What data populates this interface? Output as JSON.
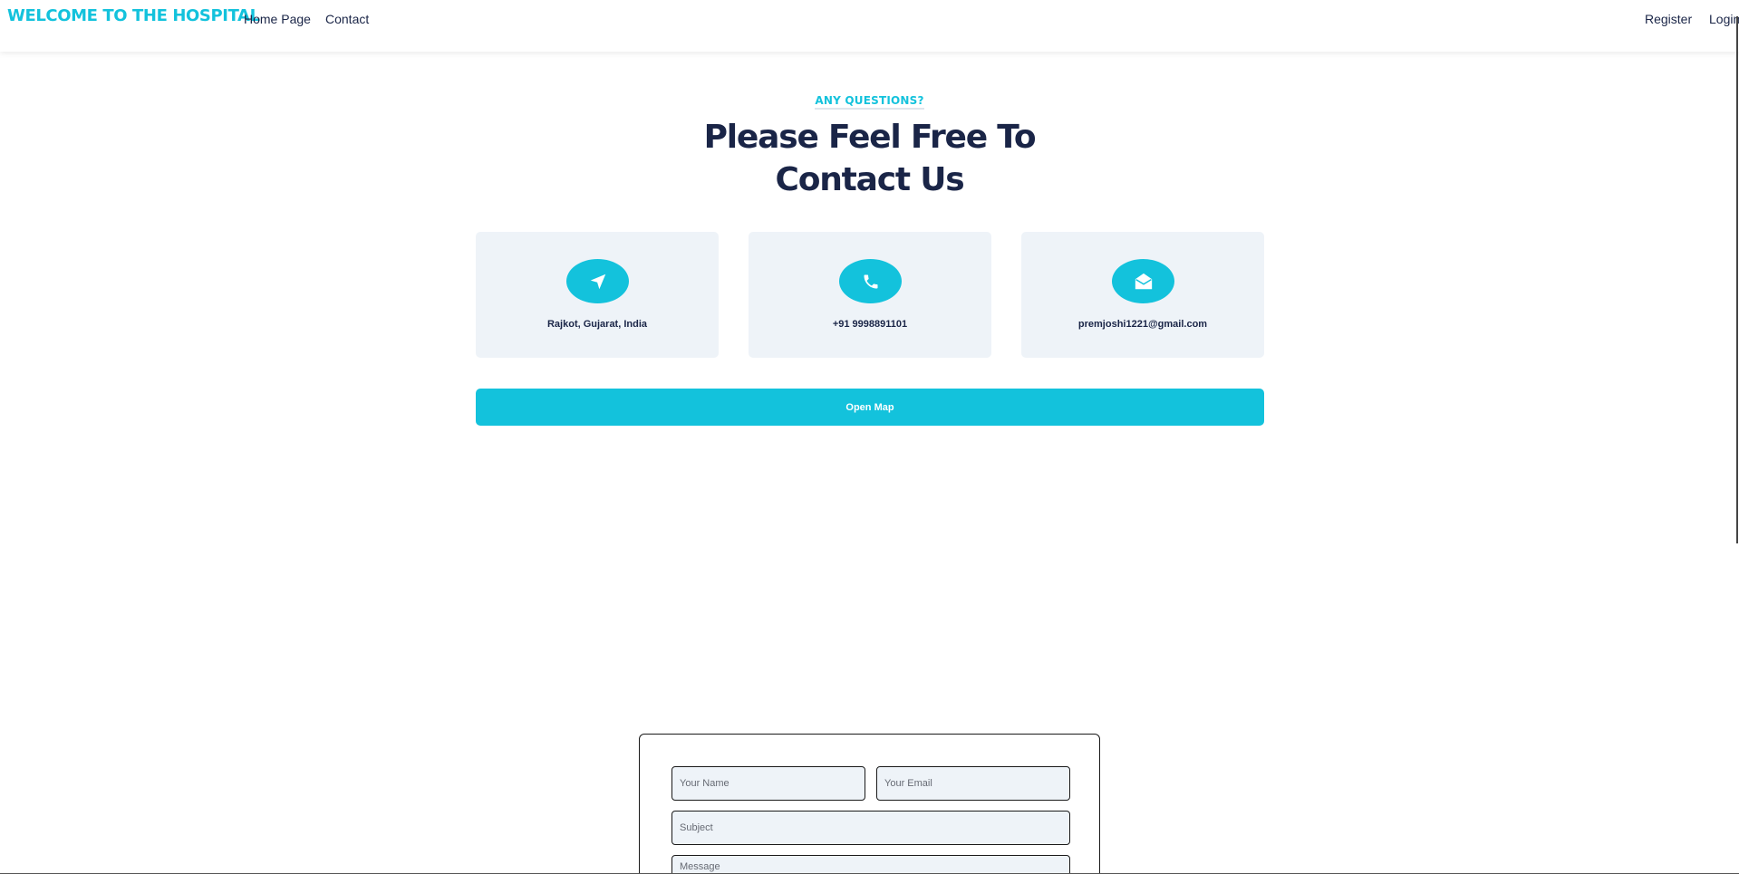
{
  "header": {
    "brand": "WELCOME TO THE HOSPITAL",
    "nav": {
      "home": "Home Page",
      "contact": "Contact",
      "register": "Register",
      "login": "Login"
    }
  },
  "hero": {
    "kicker": "ANY QUESTIONS?",
    "title_line1": "Please Feel Free To",
    "title_line2": "Contact Us"
  },
  "cards": [
    {
      "icon": "location-arrow-icon",
      "text": "Rajkot, Gujarat, India"
    },
    {
      "icon": "phone-icon",
      "text": "+91 9998891101"
    },
    {
      "icon": "envelope-open-icon",
      "text": "premjoshi1221@gmail.com"
    }
  ],
  "map_button": {
    "label": "Open Map"
  },
  "form": {
    "name_placeholder": "Your Name",
    "email_placeholder": "Your Email",
    "subject_placeholder": "Subject",
    "message_placeholder": "Message"
  },
  "colors": {
    "accent": "#13c2dc",
    "heading": "#1a2547",
    "card_bg": "#eef3f8"
  }
}
